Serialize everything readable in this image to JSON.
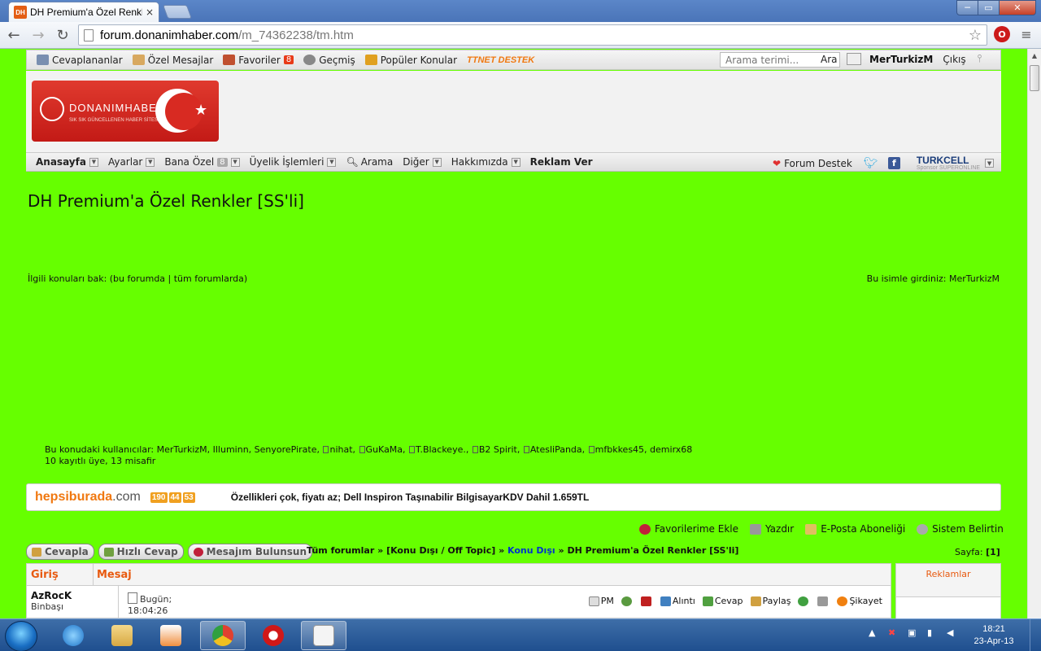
{
  "browser": {
    "tab_title": "DH Premium'a Özel Renkl",
    "tab_favicon": "DH",
    "tab_close": "×",
    "url_host": "forum.donanimhaber.com",
    "url_path": "/m_74362238/tm.htm",
    "ext_icon": "O",
    "win_min": "─",
    "win_max": "▭",
    "win_close": "✕"
  },
  "topbar": {
    "items": [
      {
        "label": "Cevaplananlar",
        "icon": "replied-icon",
        "color": "#7a8fb0"
      },
      {
        "label": "Özel Mesajlar",
        "icon": "private-messages-icon",
        "color": "#d8a860"
      },
      {
        "label": "Favoriler",
        "icon": "favorites-icon",
        "color": "#c05030",
        "badge": "8"
      },
      {
        "label": "Geçmiş",
        "icon": "history-icon",
        "color": "#888888"
      },
      {
        "label": "Popüler Konular",
        "icon": "popular-topics-icon",
        "color": "#e0a020"
      }
    ],
    "ttnet": "TTNET DESTEK",
    "search_placeholder": "Arama terimi...",
    "search_button": "Ara",
    "username": "MerTurkizM",
    "logout": "Çıkış"
  },
  "header": {
    "logo_text": "DONANIMHABER",
    "logo_sub": "SIK SIK GÜNCELLENEN HABER SİTESİ",
    "logo_star": "★"
  },
  "mainnav": {
    "items": [
      {
        "label": "Anasayfa",
        "bold": true
      },
      {
        "label": "Ayarlar"
      },
      {
        "label": "Bana Özel",
        "badge": "8"
      },
      {
        "label": "Üyelik İşlemleri"
      },
      {
        "label": "Arama"
      },
      {
        "label": "Diğer"
      },
      {
        "label": "Hakkımızda"
      },
      {
        "label": "Reklam Ver"
      }
    ],
    "forum_support": "Forum Destek",
    "turkcell": "TURKCELL",
    "superonline": "Sponsor SUPERONLINE"
  },
  "content": {
    "heading": "DH Premium'a Özel Renkler [SS'li]",
    "related": "İlgili konuları bak: (bu forumda | tüm forumlarda)",
    "entered_as": "Bu isimle girdiniz: MerTurkizM",
    "users_line1": "Bu konudaki kullanıcılar: MerTurkizM, Illuminn, SenyorePirate,",
    "users_list": [
      "nihat,",
      "GuKaMa,",
      "T.Blackeye.,",
      "B2 Spirit,",
      "AtesliPanda,",
      "mfbkkes45, demirx68"
    ],
    "users_line2": "10 kayıtlı üye, 13 misafir"
  },
  "ad": {
    "brand_main": "hepsiburada",
    "brand_suffix": ".com",
    "timer": [
      "190",
      "44",
      "53"
    ],
    "text": "Özellikleri çok, fiyatı az; Dell Inspiron Taşınabilir BilgisayarKDV Dahil 1.659TL"
  },
  "actions": [
    "Favorilerime Ekle",
    "Yazdır",
    "E-Posta Aboneliği",
    "Sistem Belirtin"
  ],
  "buttons": [
    "Cevapla",
    "Hızlı Cevap",
    "Mesajım Bulunsun"
  ],
  "breadcrumb": {
    "all": "Tüm forumlar",
    "sep": "»",
    "offtopic": "[Konu Dışı / Off Topic]",
    "konudisi": "Konu Dışı",
    "current": "DH Premium'a Özel Renkler [SS'li]"
  },
  "pager": {
    "label": "Sayfa:",
    "page": "[1]"
  },
  "post": {
    "col_login": "Giriş",
    "col_message": "Mesaj",
    "author": "AzRocK",
    "rank": "Binbaşı",
    "date_line1": "Bugün;",
    "date_line2": "18:04:26",
    "tools": [
      "PM",
      "",
      "",
      "Alıntı",
      "Cevap",
      "Paylaş",
      "",
      "",
      "Şikayet"
    ]
  },
  "sidebar": {
    "ads_title": "Reklamlar"
  },
  "taskbar": {
    "time": "18:21",
    "date": "23-Apr-13"
  }
}
